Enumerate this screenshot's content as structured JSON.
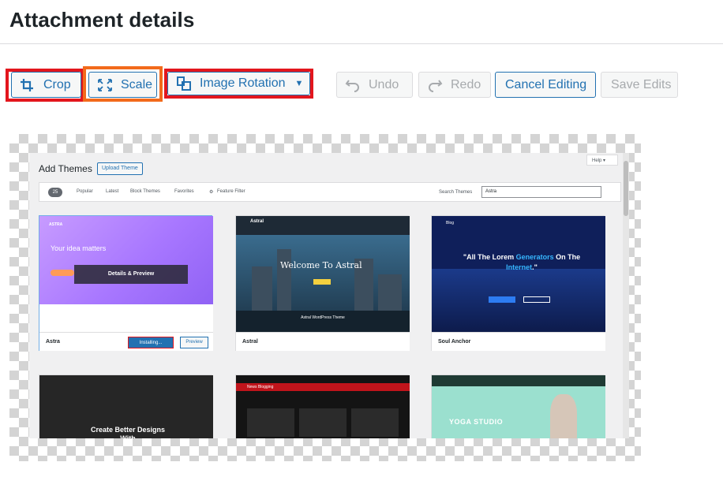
{
  "page": {
    "title": "Attachment details"
  },
  "toolbar": {
    "crop_label": "Crop",
    "scale_label": "Scale",
    "rotation_label": "Image Rotation",
    "undo_label": "Undo",
    "redo_label": "Redo",
    "cancel_label": "Cancel Editing",
    "save_label": "Save Edits"
  },
  "screenshot": {
    "heading": "Add Themes",
    "upload_label": "Upload Theme",
    "help_label": "Help ▾",
    "filters": {
      "count": "25",
      "popular": "Popular",
      "latest": "Latest",
      "block_themes": "Block Themes",
      "favorites": "Favorites",
      "feature_filter": "Feature Filter",
      "search_label": "Search Themes",
      "search_value": "Astra"
    },
    "themes": [
      {
        "name": "Astra",
        "hero_text": "Your idea matters",
        "overlay": "Details & Preview",
        "install_label": "Installing...",
        "preview_label": "Preview",
        "logo": "ASTRA"
      },
      {
        "name": "Astral",
        "hero_text": "Welcome To Astral",
        "brand": "Astral",
        "band_text": "Astral WordPress Theme"
      },
      {
        "name": "Soul Anchor",
        "quote_pre": "\"All The Lorem ",
        "quote_acc1": "Generators",
        "quote_mid": " On The ",
        "quote_acc2": "Internet",
        "quote_post": ".\"",
        "brand": "Blog"
      },
      {
        "name": "",
        "hero_text": "Create Better Designs With"
      },
      {
        "name": "",
        "banner": "News Blogging"
      },
      {
        "name": "",
        "hero_text": "YOGA STUDIO"
      }
    ]
  },
  "colors": {
    "highlight_red": "#e3161d",
    "highlight_orange": "#f26a1b",
    "wp_blue": "#2271b1"
  }
}
